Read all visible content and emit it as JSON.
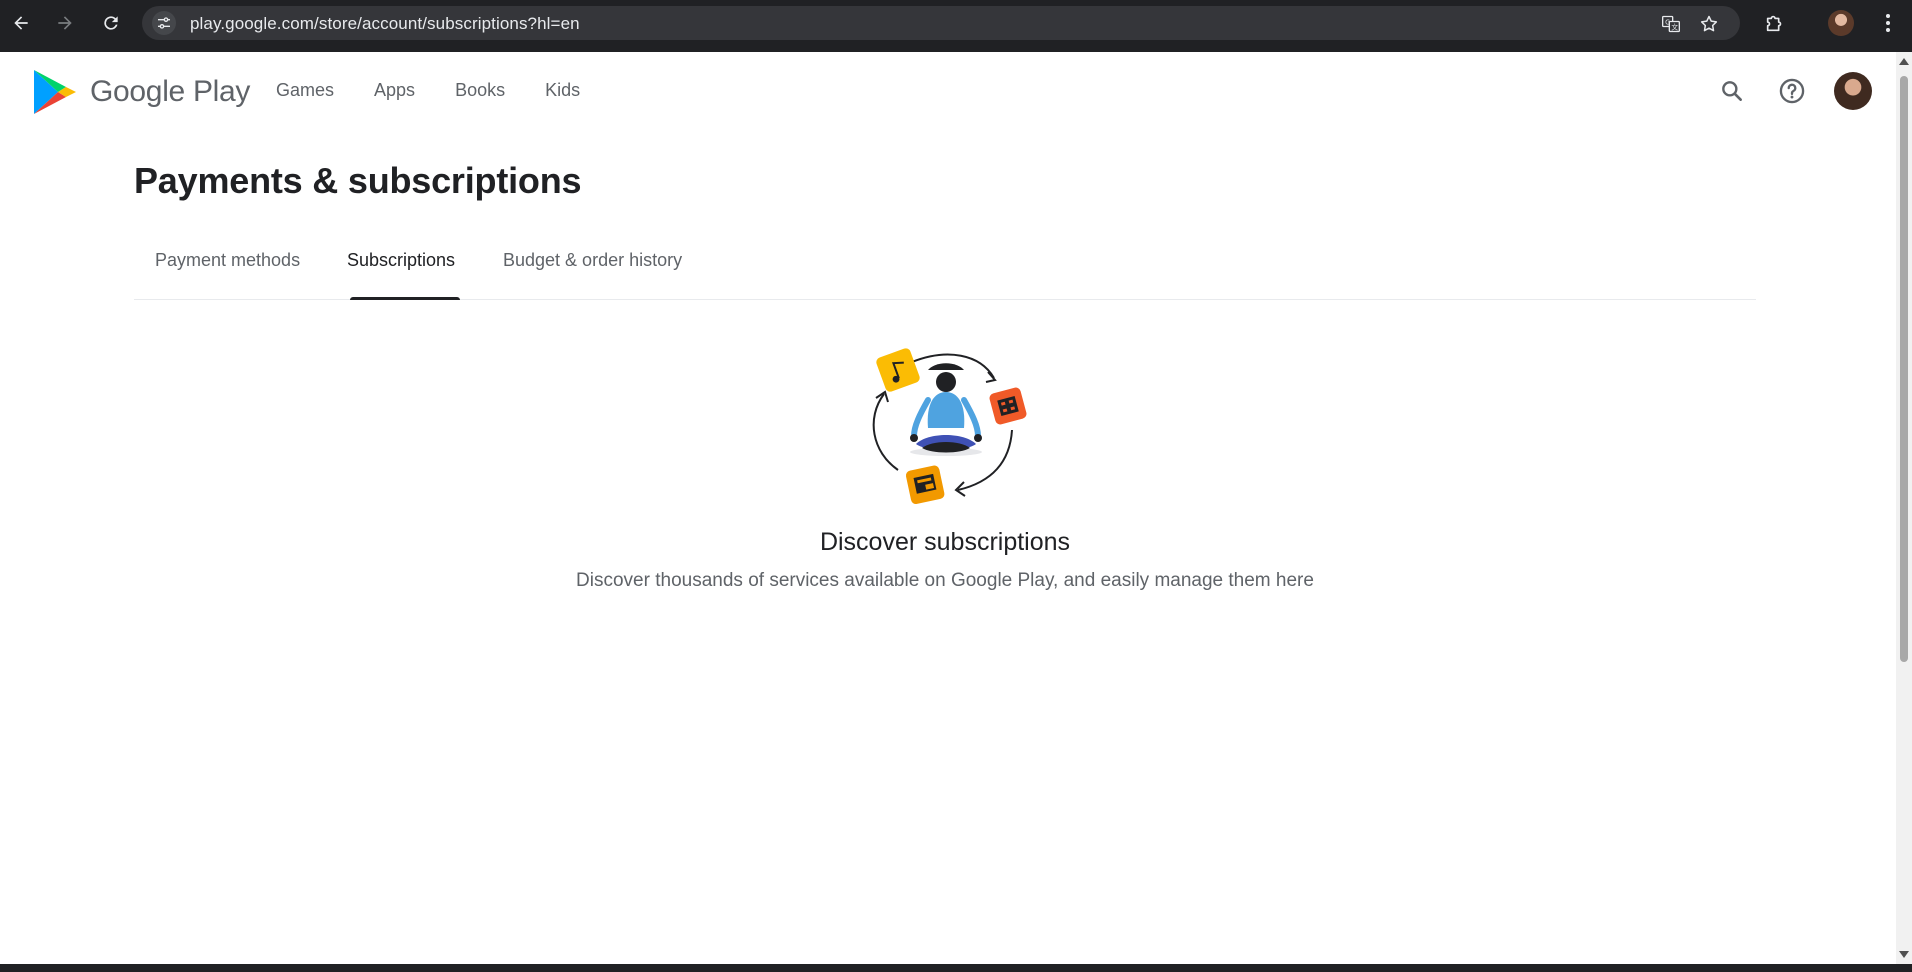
{
  "browser": {
    "url": "play.google.com/store/account/subscriptions?hl=en",
    "icons": {
      "back": "arrow-left-icon",
      "forward": "arrow-right-icon",
      "reload": "reload-icon",
      "site_info": "tune-icon",
      "translate": "translate-icon",
      "bookmark": "star-icon",
      "extensions": "puzzle-icon",
      "menu": "kebab-menu-icon"
    }
  },
  "header": {
    "brand": "Google Play",
    "nav": [
      "Games",
      "Apps",
      "Books",
      "Kids"
    ],
    "icons": {
      "search": "search-icon",
      "help": "help-circle-icon"
    }
  },
  "page": {
    "title": "Payments & subscriptions",
    "tabs": [
      {
        "label": "Payment methods",
        "active": false
      },
      {
        "label": "Subscriptions",
        "active": true
      },
      {
        "label": "Budget & order history",
        "active": false
      }
    ],
    "empty_state": {
      "title": "Discover subscriptions",
      "description": "Discover thousands of services available on Google Play, and easily manage them here"
    }
  },
  "colors": {
    "chrome_bg": "#202124",
    "omnibox_bg": "#35363a",
    "text_primary": "#202124",
    "text_secondary": "#5f6368",
    "music_yellow": "#fbbc04",
    "movies_orange": "#f05a28",
    "news_orange": "#f29900",
    "person_blue": "#4fa3e0"
  }
}
